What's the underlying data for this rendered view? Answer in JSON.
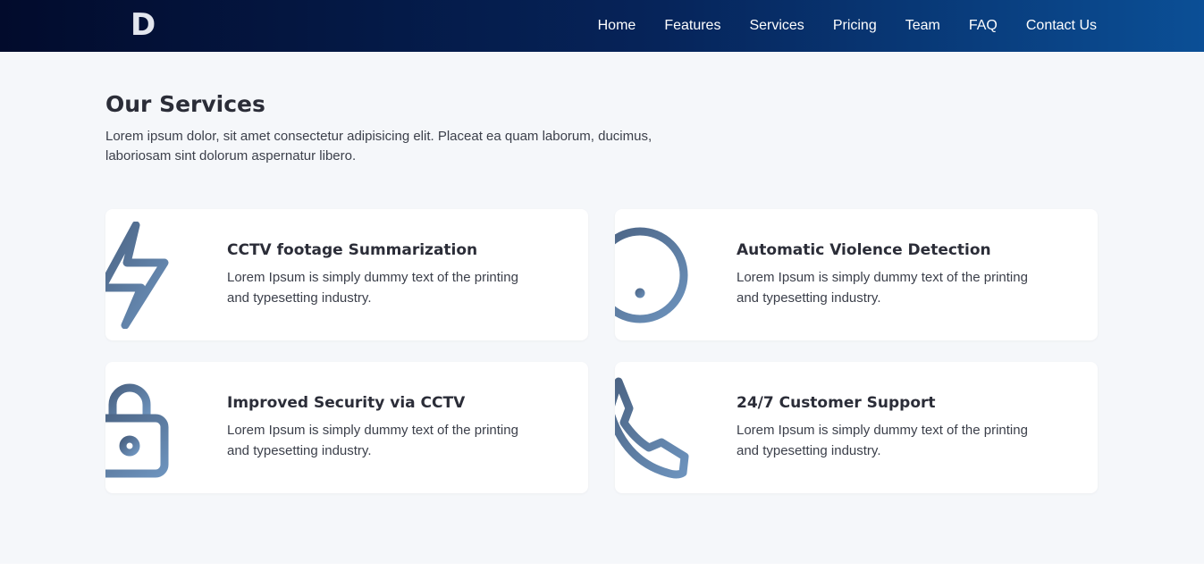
{
  "header": {
    "logo_text": "D",
    "nav": [
      "Home",
      "Features",
      "Services",
      "Pricing",
      "Team",
      "FAQ",
      "Contact Us"
    ]
  },
  "services": {
    "title": "Our Services",
    "description": "Lorem ipsum dolor, sit amet consectetur adipisicing elit. Placeat ea quam laborum, ducimus, laboriosam sint dolorum aspernatur libero.",
    "cards": [
      {
        "icon": "lightning-icon",
        "title": "CCTV footage Summarization",
        "text": "Lorem Ipsum is simply dummy text of the printing and typesetting industry."
      },
      {
        "icon": "alert-circle-icon",
        "title": "Automatic Violence Detection",
        "text": "Lorem Ipsum is simply dummy text of the printing and typesetting industry."
      },
      {
        "icon": "lock-icon",
        "title": "Improved Security via CCTV",
        "text": "Lorem Ipsum is simply dummy text of the printing and typesetting industry."
      },
      {
        "icon": "phone-icon",
        "title": "24/7 Customer Support",
        "text": "Lorem Ipsum is simply dummy text of the printing and typesetting industry."
      }
    ]
  },
  "colors": {
    "icon_gradient_start": "#4a6282",
    "icon_gradient_end": "#6d93bd",
    "nav_bg_start": "#020b2c",
    "nav_bg_end": "#0b4f96"
  }
}
